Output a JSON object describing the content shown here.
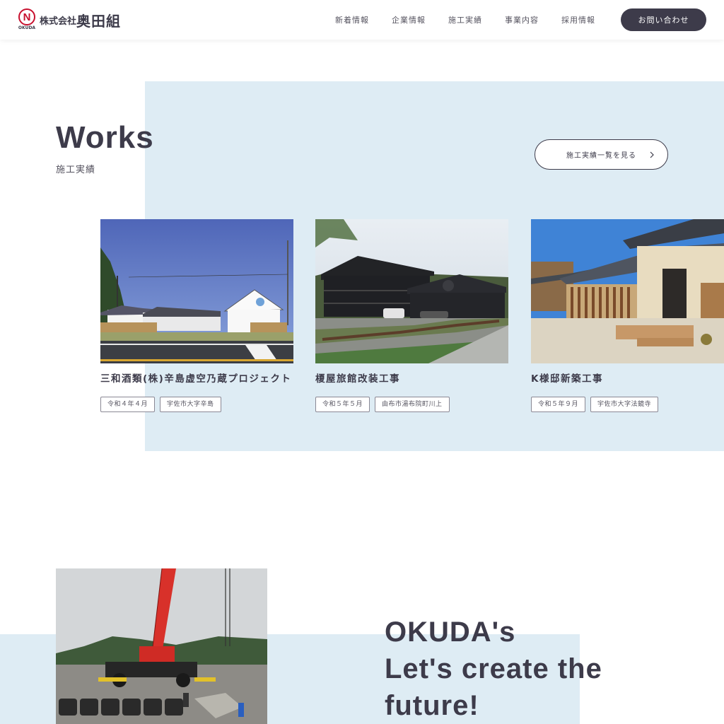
{
  "header": {
    "logo": {
      "mark_letter": "N",
      "mark_sub": "OKUDA",
      "small": "株式会社",
      "large": "奥田組"
    },
    "nav": [
      "新着情報",
      "企業情報",
      "施工実績",
      "事業内容",
      "採用情報"
    ],
    "contact_label": "お問い合わせ"
  },
  "works": {
    "title": "Works",
    "subtitle": "施工実績",
    "view_all_label": "施工実績一覧を見る",
    "cards": [
      {
        "title": "三和酒類(株)辛島虚空乃蔵プロジェクト",
        "tags": [
          "令和４年４月",
          "宇佐市大字辛島"
        ]
      },
      {
        "title": "榎屋旅館改装工事",
        "tags": [
          "令和５年５月",
          "由布市湯布院町川上"
        ]
      },
      {
        "title": "K様邸新築工事",
        "tags": [
          "令和５年９月",
          "宇佐市大字法鏡寺"
        ]
      }
    ]
  },
  "tagline": {
    "line1": "OKUDA's",
    "line2": "Let's create the",
    "line3": "future!"
  },
  "colors": {
    "primary": "#3d3b4a",
    "panel": "#deecf4",
    "logo_red": "#c8102e"
  }
}
